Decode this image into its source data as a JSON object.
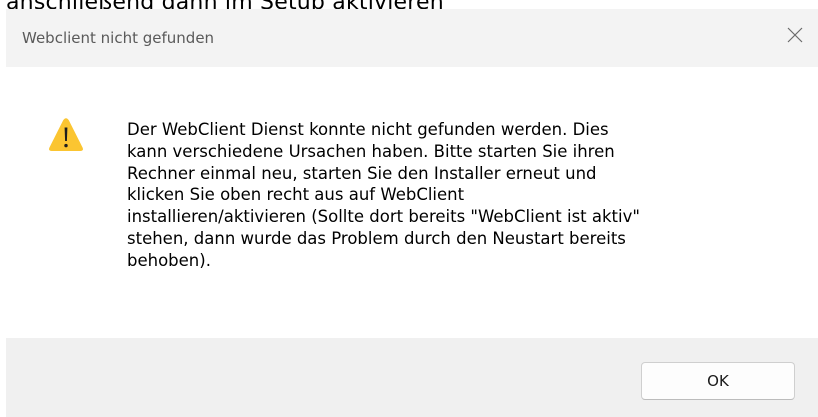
{
  "background": {
    "caption": "anschließend dann im Setup aktivieren"
  },
  "dialog": {
    "title": "Webclient nicht gefunden",
    "close_icon": "close-icon",
    "warning_icon": "warning-icon",
    "message": "Der WebClient Dienst konnte nicht gefunden werden. Dies\nkann verschiedene Ursachen haben. Bitte starten Sie ihren\nRechner einmal neu, starten Sie den Installer erneut und\nklicken Sie oben recht aus auf WebClient\ninstallieren/aktivieren (Sollte dort bereits \"WebClient ist aktiv\"\nstehen, dann wurde das Problem durch den Neustart bereits\nbehoben).",
    "ok_label": "OK"
  },
  "colors": {
    "titlebar": "#f3f3f3",
    "footer": "#f0f0f0",
    "warning_fill": "#fbc531",
    "warning_mark": "#1e1e1e"
  }
}
